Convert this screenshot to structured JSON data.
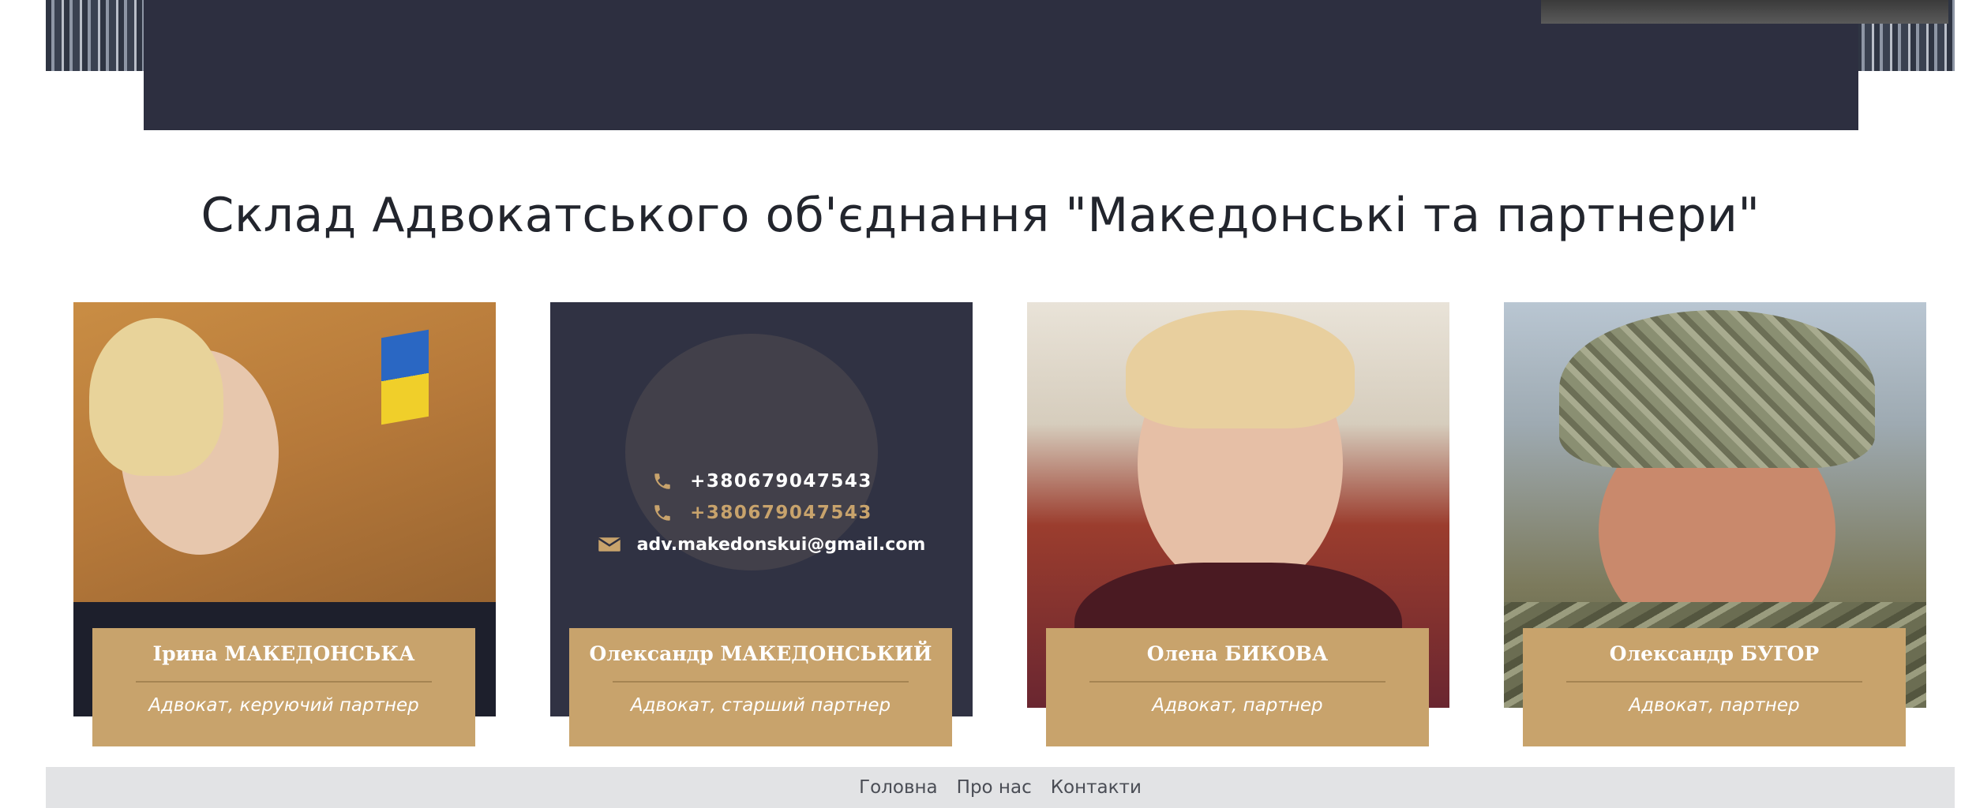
{
  "section": {
    "title": "Склад Адвокатського об'єднання \"Македонські та партнери\""
  },
  "team": [
    {
      "name": "Ірина МАКЕДОНСЬКА",
      "role": "Адвокат, керуючий партнер"
    },
    {
      "name": "Олександр МАКЕДОНСЬКИЙ",
      "role": "Адвокат, старший партнер",
      "contacts": {
        "phone1": "+380679047543",
        "phone2": "+380679047543",
        "email": "adv.makedonskui@gmail.com"
      }
    },
    {
      "name": "Олена БИКОВА",
      "role": "Адвокат, партнер"
    },
    {
      "name": "Олександр БУГОР",
      "role": "Адвокат, партнер"
    }
  ],
  "footer": {
    "links": [
      "Головна",
      "Про нас",
      "Контакти"
    ]
  },
  "colors": {
    "accent": "#c8a36c",
    "dark": "#2d2f40",
    "footer_bg": "#e2e3e5"
  }
}
